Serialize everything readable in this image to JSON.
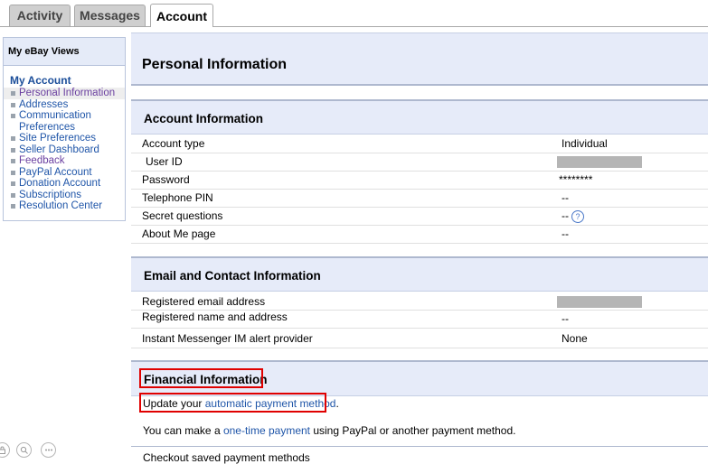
{
  "tabs": [
    {
      "label": "Activity",
      "active": false
    },
    {
      "label": "Messages",
      "active": false
    },
    {
      "label": "Account",
      "active": true
    }
  ],
  "sidebar": {
    "header": "My eBay Views",
    "section": "My Account",
    "items": [
      {
        "label": "Personal Information",
        "state": "active"
      },
      {
        "label": "Addresses",
        "state": "normal"
      },
      {
        "label": "Communication Preferences",
        "state": "normal"
      },
      {
        "label": "Site Preferences",
        "state": "normal"
      },
      {
        "label": "Seller Dashboard",
        "state": "normal"
      },
      {
        "label": "Feedback",
        "state": "visited"
      },
      {
        "label": "PayPal Account",
        "state": "normal"
      },
      {
        "label": "Donation Account",
        "state": "normal"
      },
      {
        "label": "Subscriptions",
        "state": "normal"
      },
      {
        "label": "Resolution Center",
        "state": "normal"
      }
    ]
  },
  "page": {
    "title": "Personal Information"
  },
  "account_info": {
    "header": "Account Information",
    "rows": [
      {
        "label": "Account type",
        "value": "Individual"
      },
      {
        "label": "User ID",
        "value": ""
      },
      {
        "label": "Password",
        "value": "********"
      },
      {
        "label": "Telephone PIN",
        "value": "--"
      },
      {
        "label": "Secret questions",
        "value": "--"
      },
      {
        "label": "About Me page",
        "value": "--"
      }
    ]
  },
  "email_info": {
    "header": "Email and Contact Information",
    "rows": [
      {
        "label": "Registered email address",
        "value": ""
      },
      {
        "label": "Registered name and address",
        "value": "--"
      },
      {
        "label": "Instant Messenger IM alert provider",
        "value": "None"
      }
    ]
  },
  "financial_info": {
    "header": "Financial Information",
    "update_prefix": "Update your ",
    "update_link": "automatic payment method",
    "update_suffix": ".",
    "onetime_prefix": "You can make a ",
    "onetime_link": "one-time payment",
    "onetime_suffix": " using PayPal or another payment method.",
    "checkout_label": "Checkout saved payment methods"
  },
  "icons": {
    "help": "question-mark-icon",
    "bottom": [
      "lock-icon",
      "magnifier-icon",
      "more-icon"
    ]
  },
  "colors": {
    "link": "#1f55a8",
    "visited_link": "#6a3fa0",
    "highlight_box": "#e00000",
    "section_bg": "#e6ebf9"
  }
}
